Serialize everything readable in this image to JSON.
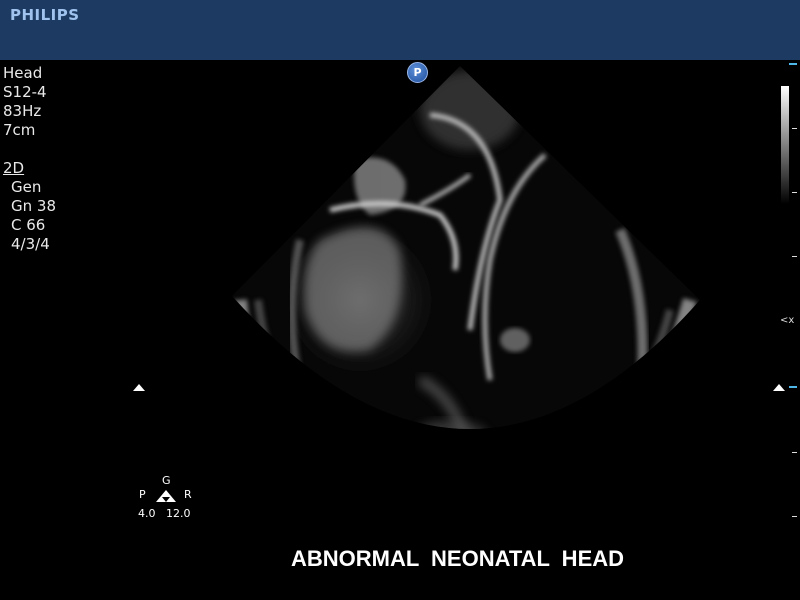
{
  "header": {
    "brand": "PHILIPS"
  },
  "params": {
    "exam": "Head",
    "probe": "S12-4",
    "frame_rate": "83Hz",
    "depth": "7cm",
    "mode": "2D",
    "preset": "Gen",
    "gain": "Gn 38",
    "compression": "C 66",
    "persistence": "4/3/4"
  },
  "probe_badge": "P",
  "orientation": {
    "top": "G",
    "left": "P",
    "right": "R",
    "value_left": "4.0",
    "value_right": "12.0"
  },
  "focus_marker": "<x",
  "caption": "ABNORMAL  NEONATAL  HEAD",
  "colors": {
    "header_bg": "#1d3a62",
    "brand": "#9fc3ee",
    "marker_blue": "#4fb7e8"
  }
}
